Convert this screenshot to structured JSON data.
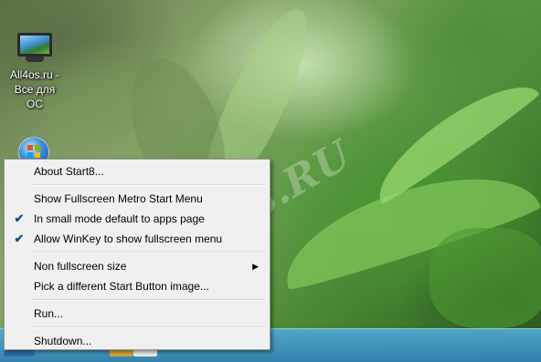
{
  "desktop": {
    "icon_label_line1": "All4os.ru -",
    "icon_label_line2": "Все для ОС",
    "watermark": "All4os.RU"
  },
  "context_menu": {
    "items": [
      {
        "label": "About Start8...",
        "checked": false
      },
      {
        "label": "Show Fullscreen Metro Start Menu",
        "checked": false
      },
      {
        "label": "In small mode default to apps page",
        "checked": true
      },
      {
        "label": "Allow WinKey to show fullscreen menu",
        "checked": true
      },
      {
        "label": "Non fullscreen size",
        "checked": false,
        "submenu": true
      },
      {
        "label": "Pick a different Start Button image...",
        "checked": false
      },
      {
        "label": "Run...",
        "checked": false
      },
      {
        "label": "Shutdown...",
        "checked": false
      }
    ],
    "check_glyph": "✔",
    "submenu_glyph": "▶"
  }
}
